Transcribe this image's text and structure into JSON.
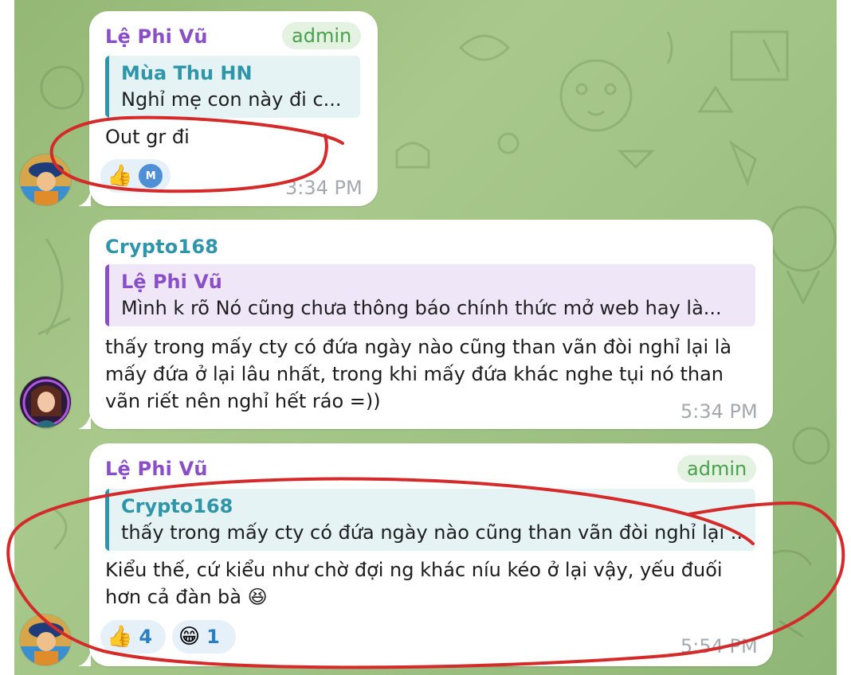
{
  "messages": [
    {
      "sender": "Lệ Phi Vũ",
      "badge": "admin",
      "reply_to": {
        "name": "Mùa Thu HN",
        "text": "Nghỉ mẹ con này đi c..."
      },
      "text": "Out gr đi",
      "reactions": [
        {
          "emoji": "👍",
          "avatar_initial": "M"
        }
      ],
      "time": "3:34 PM"
    },
    {
      "sender": "Crypto168",
      "reply_to": {
        "name": "Lệ Phi Vũ",
        "text": "Mình k rõ  Nó cũng chưa thông báo chính thức mở web hay là..."
      },
      "text_lines": [
        "thấy trong mấy cty có đứa ngày nào cũng than vãn đòi nghỉ lại là",
        "mấy đứa ở lại lâu nhất, trong khi mấy đứa khác nghe tụi nó than",
        "vãn riết nên nghỉ hết ráo =))"
      ],
      "time": "5:34 PM"
    },
    {
      "sender": "Lệ Phi Vũ",
      "badge": "admin",
      "reply_to": {
        "name": "Crypto168",
        "text": "thấy trong mấy cty có đứa ngày nào cũng than vãn đòi nghỉ lại ..."
      },
      "text_lines": [
        "Kiểu thế, cứ kiểu như chờ đợi ng khác níu kéo ở lại vậy, yếu đuối",
        "hơn cả đàn bà 😆"
      ],
      "reactions": [
        {
          "emoji": "👍",
          "count": "4"
        },
        {
          "emoji": "😁",
          "count": "1"
        }
      ],
      "time": "5:54 PM"
    }
  ],
  "colors": {
    "admin_name": "#8a4fc6",
    "crypto_name": "#2f95a8",
    "annotation": "#d42a2a",
    "chat_background": "#9ec183"
  },
  "icons": [
    "avatar-le-phi-vu",
    "avatar-crypto168",
    "doodle-pattern"
  ]
}
